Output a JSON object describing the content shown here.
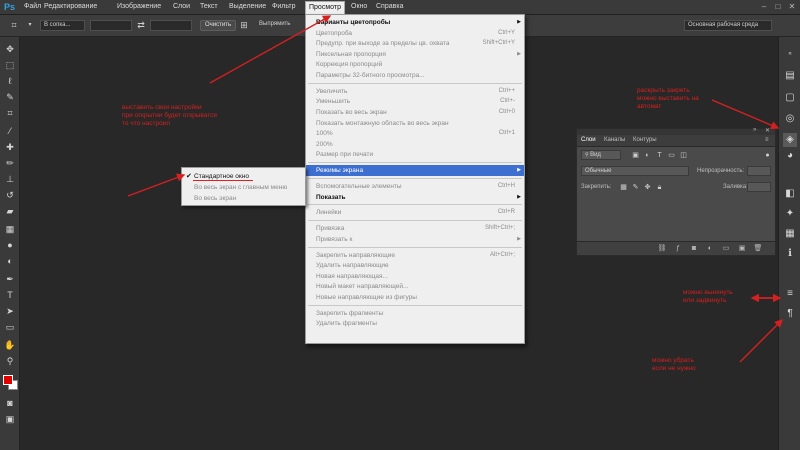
{
  "app": {
    "logo": "Ps"
  },
  "menubar": {
    "items": [
      "Файл",
      "Редактирование",
      "Изображение",
      "Слои",
      "Текст",
      "Выделение",
      "Фильтр",
      "Просмотр",
      "Окно",
      "Справка"
    ],
    "active": "Просмотр",
    "window_controls": [
      "–",
      "□",
      "✕"
    ]
  },
  "options": {
    "style_value": "В сопка...",
    "width_value": "",
    "height_value": "",
    "clear_label": "Очистить",
    "straighten_label": "Выпрямить",
    "workspace": "Основная рабочая среда"
  },
  "view_menu": {
    "items": [
      {
        "label": "Варианты цветопробы",
        "shortcut": "",
        "arrow": "▶",
        "state": "normal"
      },
      {
        "label": "Цветопроба",
        "shortcut": "Ctrl+Y",
        "arrow": "",
        "state": "disabled"
      },
      {
        "label": "Предупр. при выходе за пределы цв. охвата",
        "shortcut": "Shift+Ctrl+Y",
        "arrow": "",
        "state": "disabled"
      },
      {
        "label": "Пиксельная пропорция",
        "shortcut": "",
        "arrow": "▶",
        "state": "disabled"
      },
      {
        "label": "Коррекция пропорций",
        "shortcut": "",
        "arrow": "",
        "state": "disabled"
      },
      {
        "label": "Параметры 32-битного просмотра...",
        "shortcut": "",
        "arrow": "",
        "state": "disabled"
      },
      {
        "label": "Увеличить",
        "shortcut": "Ctrl++",
        "arrow": "",
        "state": "disabled"
      },
      {
        "label": "Уменьшить",
        "shortcut": "Ctrl+-",
        "arrow": "",
        "state": "disabled"
      },
      {
        "label": "Показать во весь экран",
        "shortcut": "Ctrl+0",
        "arrow": "",
        "state": "disabled"
      },
      {
        "label": "Показать монтажную область во весь экран",
        "shortcut": "",
        "arrow": "",
        "state": "disabled"
      },
      {
        "label": "100%",
        "shortcut": "Ctrl+1",
        "arrow": "",
        "state": "disabled"
      },
      {
        "label": "200%",
        "shortcut": "",
        "arrow": "",
        "state": "disabled"
      },
      {
        "label": "Размер при печати",
        "shortcut": "",
        "arrow": "",
        "state": "disabled"
      },
      {
        "label": "Режимы экрана",
        "shortcut": "",
        "arrow": "▶",
        "state": "highlighted"
      },
      {
        "label": "Вспомогательные элементы",
        "shortcut": "Ctrl+H",
        "arrow": "",
        "state": "disabled"
      },
      {
        "label": "Показать",
        "shortcut": "",
        "arrow": "▶",
        "state": "normal"
      },
      {
        "label": "Линейки",
        "shortcut": "Ctrl+R",
        "arrow": "",
        "state": "disabled"
      },
      {
        "label": "Привязка",
        "shortcut": "Shift+Ctrl+;",
        "arrow": "",
        "state": "disabled"
      },
      {
        "label": "Привязать к",
        "shortcut": "",
        "arrow": "▶",
        "state": "disabled"
      },
      {
        "label": "Закрепить направляющие",
        "shortcut": "Alt+Ctrl+;",
        "arrow": "",
        "state": "disabled"
      },
      {
        "label": "Удалить направляющие",
        "shortcut": "",
        "arrow": "",
        "state": "disabled"
      },
      {
        "label": "Новая направляющая...",
        "shortcut": "",
        "arrow": "",
        "state": "disabled"
      },
      {
        "label": "Новый макет направляющей...",
        "shortcut": "",
        "arrow": "",
        "state": "disabled"
      },
      {
        "label": "Новые направляющие из фигуры",
        "shortcut": "",
        "arrow": "",
        "state": "disabled"
      },
      {
        "label": "Закрепить фрагменты",
        "shortcut": "",
        "arrow": "",
        "state": "disabled"
      },
      {
        "label": "Удалить фрагменты",
        "shortcut": "",
        "arrow": "",
        "state": "disabled"
      }
    ]
  },
  "screen_mode_submenu": {
    "items": [
      {
        "label": "Стандартное окно",
        "checked": true
      },
      {
        "label": "Во весь экран с главным меню",
        "checked": false
      },
      {
        "label": "Во весь экран",
        "checked": false
      }
    ],
    "check": "✔"
  },
  "layers_panel": {
    "tabs": [
      "Слои",
      "Каналы",
      "Контуры"
    ],
    "active_tab": "Слои",
    "kind_filter": "Вид",
    "blend_mode": "Обычные",
    "opacity_label": "Непрозрачность:",
    "lock_label": "Закрепить:",
    "fill_label": "Заливка:",
    "collapse": "»",
    "menu": "≡"
  },
  "annotations": [
    "выставить свои настройки\nпри открытии будет открыватся\nто что настроил",
    "раскрыть закреть\nможно выставить на\nавтомат",
    "можно вынянуть\nили задвинуть",
    "можно убрать\nесли не нужно"
  ],
  "colors": {
    "accent": "#3d6fd0",
    "annotation": "#d42020",
    "foreground_swatch": "#e00000",
    "background_swatch": "#ffffff"
  },
  "icons": {
    "left_tools": [
      "move-icon",
      "marquee-icon",
      "lasso-icon",
      "quick-select-icon",
      "crop-icon",
      "eyedropper-icon",
      "healing-icon",
      "brush-icon",
      "stamp-icon",
      "history-brush-icon",
      "eraser-icon",
      "gradient-icon",
      "blur-icon",
      "dodge-icon",
      "pen-icon",
      "type-icon",
      "path-select-icon",
      "shape-icon",
      "hand-icon",
      "zoom-icon"
    ],
    "right_dock": [
      "history-icon",
      "layers-icon",
      "color-icon",
      "adjustments-icon",
      "swatches-icon",
      "styles-icon",
      "info-icon",
      "properties-icon",
      "character-icon"
    ]
  }
}
